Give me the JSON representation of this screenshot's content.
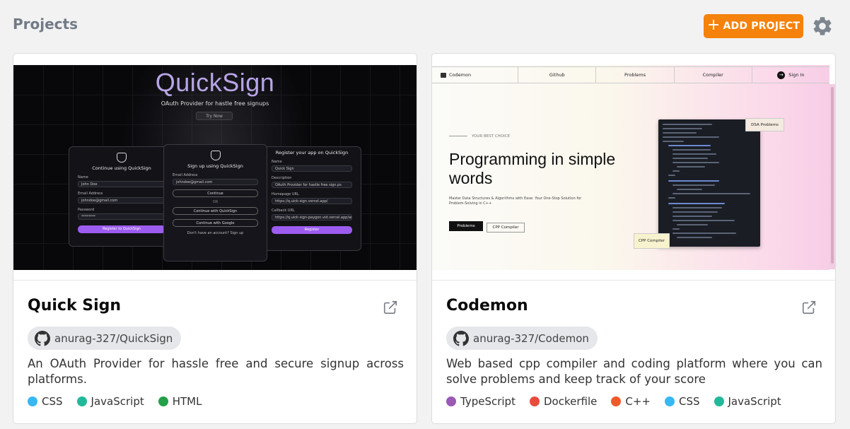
{
  "header": {
    "title": "Projects",
    "add_button": {
      "icon": "plus-icon",
      "label": "ADD PROJECT"
    },
    "settings_icon": "gear-icon"
  },
  "colors": {
    "accent": "#f5820b",
    "title_gray": "#727a86",
    "chip_bg": "#e5e7ea"
  },
  "projects": [
    {
      "title": "Quick Sign",
      "repo": "anurag-327/QuickSign",
      "description": "An OAuth Provider for hassle free and secure signup across platforms.",
      "languages": [
        {
          "name": "CSS",
          "color": "#37b8f2"
        },
        {
          "name": "JavaScript",
          "color": "#22b89a"
        },
        {
          "name": "HTML",
          "color": "#24a048"
        }
      ],
      "preview": {
        "logo": "QuickSign",
        "subtitle": "OAuth Provider for hastle free signups",
        "try_button": "Try Now",
        "left_panel": {
          "heading": "Continue using QuickSign",
          "name_label": "Name",
          "name_value": "John Doe",
          "email_label": "Email Address",
          "email_value": "johndoe@gmail.com",
          "password_label": "Password",
          "password_value": "********",
          "button": "Register to QuickSign"
        },
        "center_panel": {
          "heading": "Sign up using QuickSign",
          "email_label": "Email Address",
          "email_value": "johndoe@gmail.com",
          "continue": "Continue",
          "or": "OR",
          "quicksign_button": "Continue with QuickSign",
          "google_button": "Continue with Google",
          "footer": "Don't have an account? Sign up"
        },
        "right_panel": {
          "heading": "Register your app on QuickSign",
          "name_label": "Name",
          "name_value": "Quick Sign",
          "desc_label": "Description",
          "desc_value": "OAuth Provider for hastle free sign.ps",
          "home_label": "Homepage URL",
          "home_value": "https://q.uick-sign.vercel.app/",
          "callback_label": "Callback URL",
          "callback_value": "https://q.uick-sign-paygon.vid.vercel.app/auth/login",
          "button": "Register"
        }
      }
    },
    {
      "title": "Codemon",
      "repo": "anurag-327/Codemon",
      "description": "Web based cpp compiler and coding platform where you can solve problems and keep track of your score",
      "languages": [
        {
          "name": "TypeScript",
          "color": "#9b59b6"
        },
        {
          "name": "Dockerfile",
          "color": "#e84c3d"
        },
        {
          "name": "C++",
          "color": "#f05a28"
        },
        {
          "name": "CSS",
          "color": "#37b8f2"
        },
        {
          "name": "JavaScript",
          "color": "#22b89a"
        }
      ],
      "preview": {
        "nav": [
          "Codemon",
          "Github",
          "Problems",
          "Compiler",
          "Sign In"
        ],
        "eyebrow": "YOUR BEST CHOICE",
        "headline": "Programming in simple words",
        "paragraph": "Master Data Structures & Algorithms with Ease: Your One-Stop Solution for Problem-Solving in C++",
        "primary_button": "Problems",
        "secondary_button": "CPP Compiler",
        "tag_top": "DSA Problems",
        "tag_bottom": "CPP Compiler"
      }
    }
  ]
}
